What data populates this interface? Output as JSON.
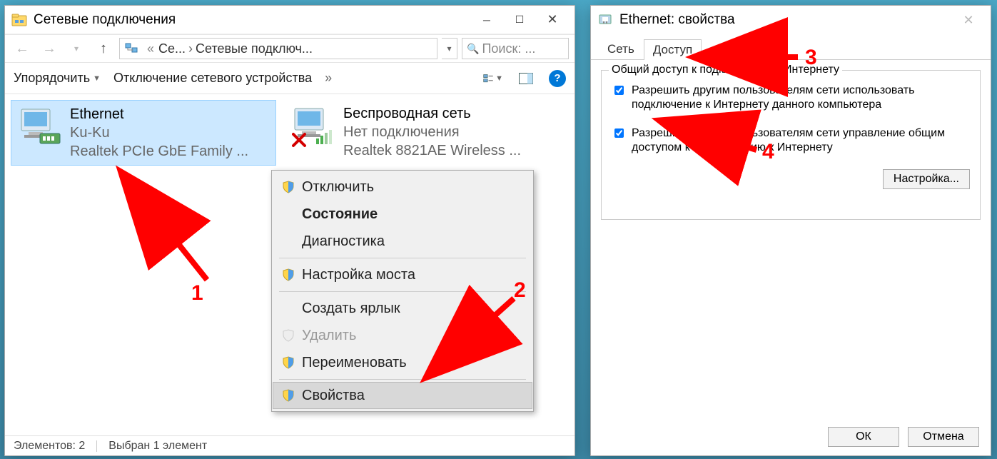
{
  "win1": {
    "title": "Сетевые подключения",
    "breadcrumb": {
      "part1": "Се...",
      "part2": "Сетевые подключ...",
      "search_placeholder": "Поиск: ..."
    },
    "toolbar": {
      "organize": "Упорядочить",
      "disable": "Отключение сетевого устройства"
    },
    "items": [
      {
        "name": "Ethernet",
        "status": "Ku-Ku",
        "device": "Realtek PCIe GbE Family ..."
      },
      {
        "name": "Беспроводная сеть",
        "status": "Нет подключения",
        "device": "Realtek 8821AE Wireless ..."
      }
    ],
    "context_menu": {
      "disable": "Отключить",
      "status": "Состояние",
      "diagnose": "Диагностика",
      "bridge": "Настройка моста",
      "shortcut": "Создать ярлык",
      "delete": "Удалить",
      "rename": "Переименовать",
      "properties": "Свойства"
    },
    "statusbar": {
      "count": "Элементов: 2",
      "selected": "Выбран 1 элемент"
    }
  },
  "win2": {
    "title": "Ethernet: свойства",
    "tabs": {
      "network": "Сеть",
      "sharing": "Доступ"
    },
    "group_label": "Общий доступ к подключению к Интернету",
    "chk1": "Разрешить другим пользователям сети использовать подключение к Интернету данного компьютера",
    "chk2": "Разрешить другим пользователям сети управление общим доступом к подключению к Интернету",
    "settings_btn": "Настройка...",
    "ok": "ОК",
    "cancel": "Отмена"
  },
  "annotations": {
    "n1": "1",
    "n2": "2",
    "n3": "3",
    "n4": "4"
  }
}
